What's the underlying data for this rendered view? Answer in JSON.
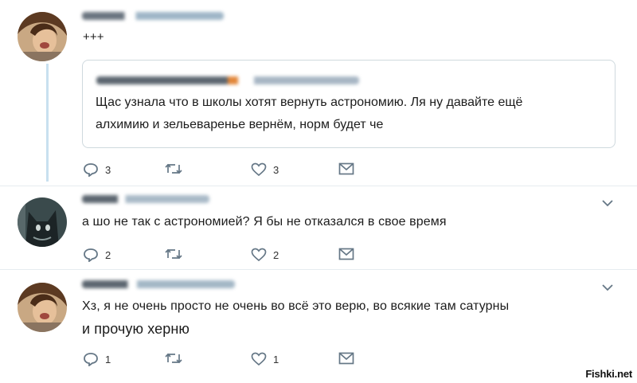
{
  "tweets": [
    {
      "text": "+++",
      "quote": {
        "line1": "Щас узнала что в школы хотят вернуть астрономию. Ля ну давайте ещё",
        "line2": "алхимию и зельеваренье вернём, норм будет че"
      },
      "replies": "3",
      "likes": "3"
    },
    {
      "text": "а шо не так  с астрономией? Я бы не отказался в свое время",
      "replies": "2",
      "likes": "2"
    },
    {
      "text_line1": "Хз, я не очень просто не очень во всё это верю, во всякие там сатурны",
      "text_line2": "и прочую херню",
      "replies": "1",
      "likes": "1"
    }
  ],
  "icons": {
    "reply": "reply-icon",
    "retweet": "retweet-icon",
    "like": "heart-icon",
    "message": "envelope-icon",
    "more": "chevron-down-icon"
  },
  "colors": {
    "action_gray": "#657786",
    "thread_line": "#c8e0ef",
    "border": "#cfd9de"
  },
  "watermark": "Fishki.net"
}
